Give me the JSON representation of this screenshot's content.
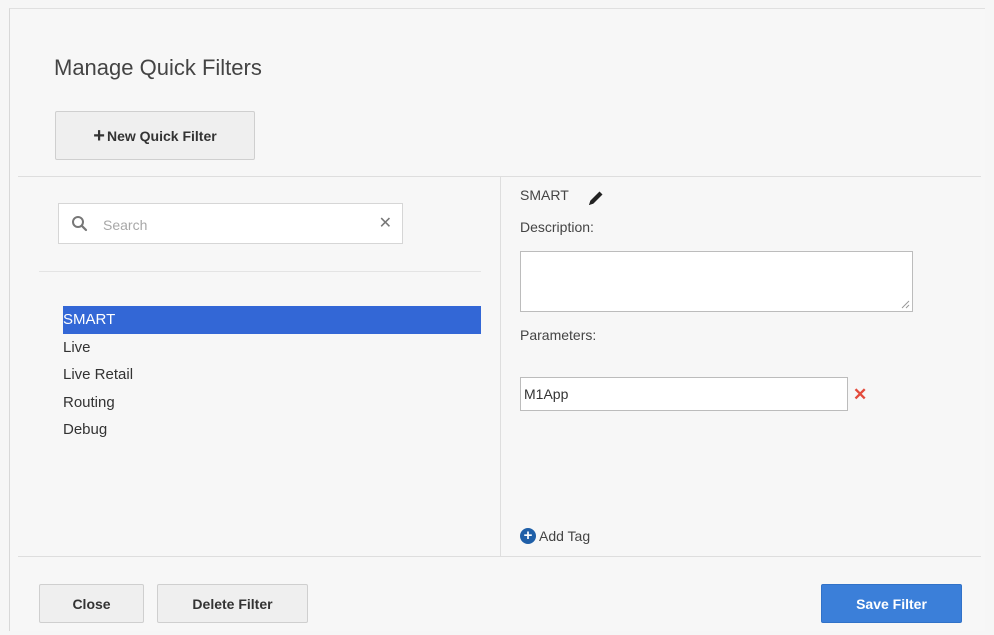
{
  "dialog": {
    "title": "Manage Quick Filters",
    "new_filter_button": "New Quick Filter"
  },
  "search": {
    "placeholder": "Search",
    "value": ""
  },
  "filters": [
    {
      "label": "SMART",
      "selected": true
    },
    {
      "label": "Live",
      "selected": false
    },
    {
      "label": "Live Retail",
      "selected": false
    },
    {
      "label": "Routing",
      "selected": false
    },
    {
      "label": "Debug",
      "selected": false
    }
  ],
  "detail": {
    "filter_name": "SMART",
    "description_label": "Description:",
    "description_value": "",
    "parameters_label": "Parameters:",
    "parameters": [
      "M1App"
    ],
    "add_tag_label": "Add Tag"
  },
  "footer": {
    "close_label": "Close",
    "delete_label": "Delete Filter",
    "save_label": "Save Filter"
  },
  "colors": {
    "selection": "#3367d6",
    "primary_button": "#3b7fd9",
    "remove_icon": "#e34b3c",
    "add_icon": "#1f5fa8"
  },
  "icons": {
    "search": "search-icon",
    "clear": "clear-search-icon",
    "edit": "pencil-icon",
    "remove": "close-icon",
    "add": "plus-circle-icon",
    "new": "plus-icon"
  }
}
